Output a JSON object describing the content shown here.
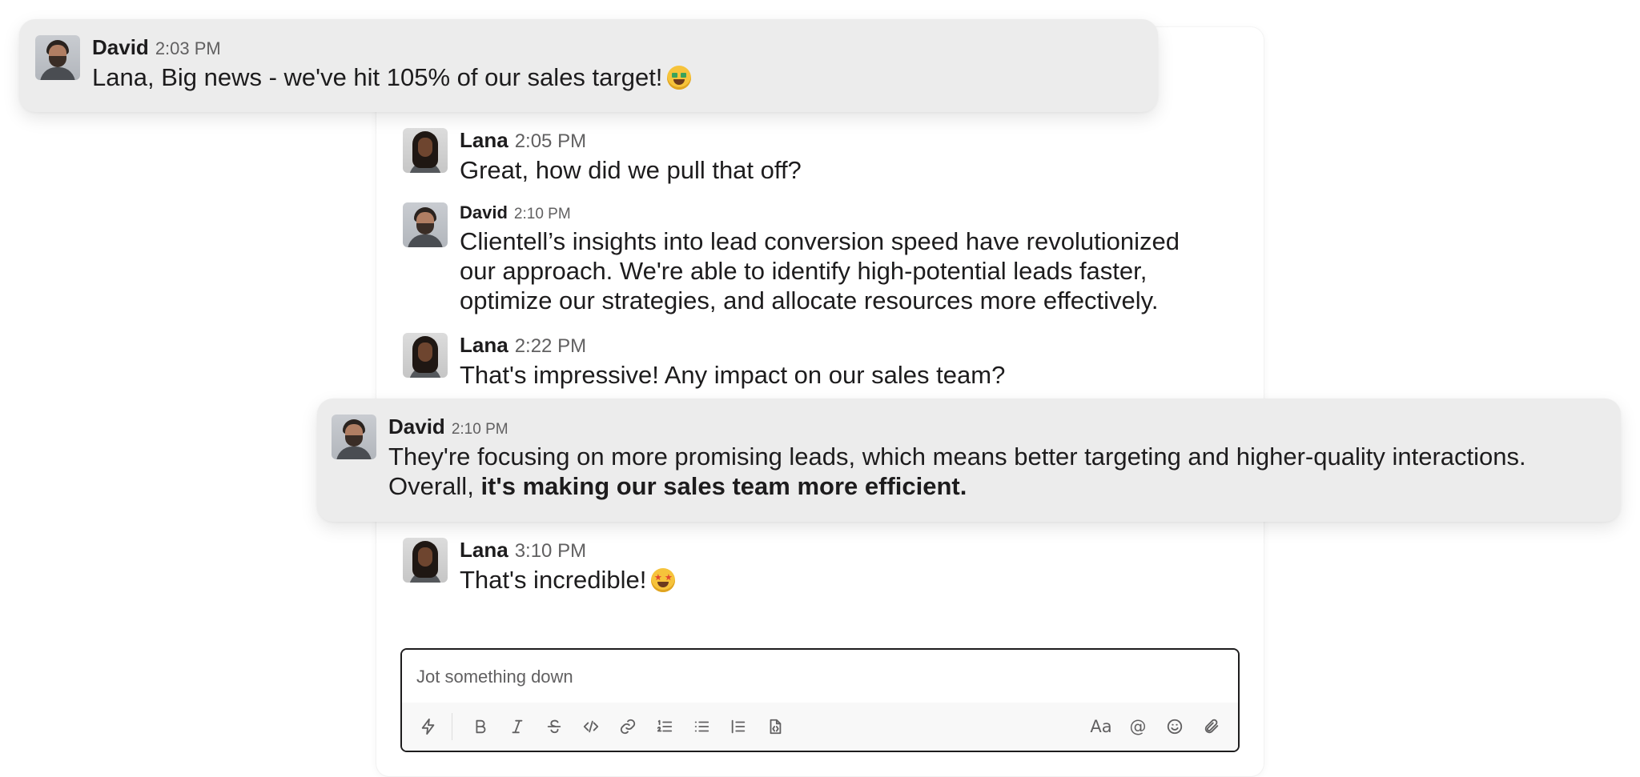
{
  "messages": [
    {
      "author": "David",
      "time": "2:03 PM",
      "text": "Lana, Big news - we've hit 105% of our sales target!",
      "emoji": "money-mouth-face-emoji"
    },
    {
      "author": "Lana",
      "time": "2:05 PM",
      "text": "Great, how did we pull that off?"
    },
    {
      "author": "David",
      "time": "2:10 PM",
      "lines": [
        "Clientell’s insights into lead conversion speed have revolutionized",
        "our approach. We're able to identify high-potential leads faster,",
        "optimize our strategies, and allocate resources more effectively."
      ]
    },
    {
      "author": "Lana",
      "time": "2:22 PM",
      "text": "That's impressive! Any impact on our sales team?"
    },
    {
      "author": "David",
      "time": "2:10 PM",
      "line1": "They're focusing on more promising leads, which means better targeting and higher-quality interactions.",
      "line2_prefix": "Overall,",
      "line2_bold": "it's making our sales team more efficient."
    },
    {
      "author": "Lana",
      "time": "3:10 PM",
      "text": "That's incredible!",
      "emoji": "star-struck-emoji"
    }
  ],
  "composer": {
    "placeholder": "Jot something down",
    "toolbar_left": [
      "shortcuts-icon"
    ],
    "formatting": [
      "bold-icon",
      "italic-icon",
      "strikethrough-icon",
      "code-icon",
      "link-icon",
      "ordered-list-icon",
      "bulleted-list-icon",
      "blockquote-icon",
      "code-block-icon"
    ],
    "toolbar_right": [
      "text-formatting-icon",
      "mention-icon",
      "emoji-icon",
      "attachment-icon"
    ]
  },
  "colors": {
    "card_background": "#ececec",
    "text_primary": "#1d1c1d",
    "text_secondary": "#616061",
    "composer_border": "#1d1c1d"
  }
}
